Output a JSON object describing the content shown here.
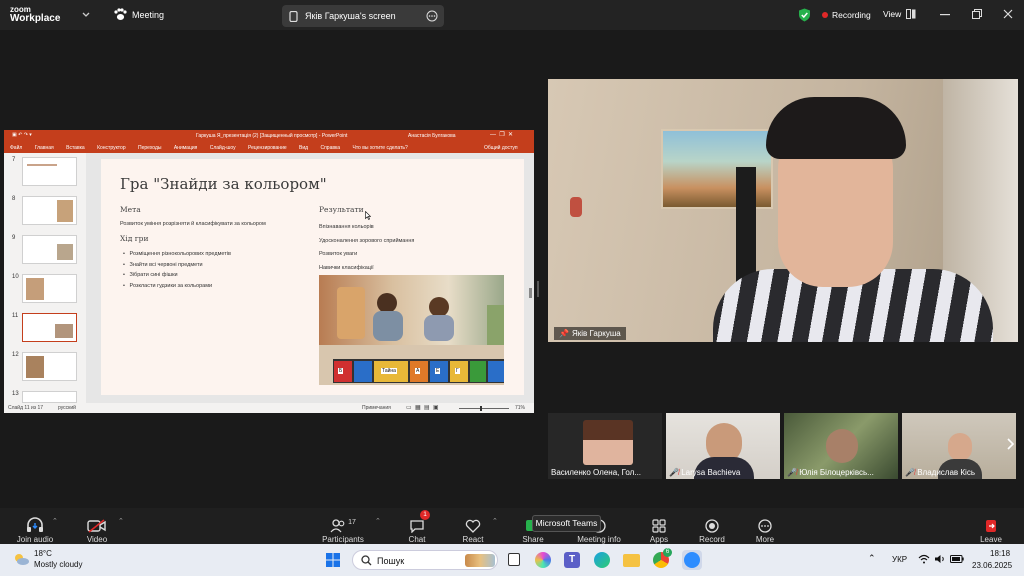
{
  "zoom": {
    "app_line1": "zoom",
    "app_line2": "Workplace",
    "meeting_label": "Meeting",
    "screen_label": "Яків Гаркуша's screen",
    "recording_label": "Recording",
    "view_label": "View"
  },
  "ppt": {
    "title": "Гаркуша Я_презентація (2) [Защищенный просмотр] - PowerPoint",
    "user": "Анастасія Булгакова",
    "menu": [
      "Файл",
      "Главная",
      "Вставка",
      "Конструктор",
      "Переходы",
      "Анимация",
      "Слайд-шоу",
      "Рецензирование",
      "Вид",
      "Справка"
    ],
    "tell_me": "Что вы хотите сделать?",
    "share": "Общий доступ",
    "thumb_numbers": [
      "7",
      "8",
      "9",
      "10",
      "11",
      "12",
      "13"
    ],
    "status_left": "Слайд 11 из 17",
    "status_lang": "русский",
    "status_notes": "Примечания",
    "status_zoom": "71%",
    "slide": {
      "title": "Гра \"Знайди за кольором\"",
      "left_heading": "Мета",
      "left_text": "Розвиток уміння розрізняти й класифікувати за кольором",
      "steps_heading": "Хід гри",
      "steps": [
        "Розміщення різнокольорових предметів",
        "Знайти всі червоні предмети",
        "Зібрати сині фішки",
        "Розкласти гудзики за кольорами"
      ],
      "right_heading": "Результати",
      "results": [
        "Впізнавання кольорів",
        "Удосконалення зорового сприймання",
        "Розвиток уваги",
        "Навички класифікації"
      ],
      "box_letters": [
        "Б",
        "Т",
        "А",
        "Е",
        "Г"
      ],
      "box_label": "Тайна"
    }
  },
  "speaker": {
    "name": "Яків Гаркуша"
  },
  "participants": [
    {
      "name": "Василенко Олена, Гол..."
    },
    {
      "name": "Larysa Bachieva"
    },
    {
      "name": "Юлія Білоцерківсь..."
    },
    {
      "name": "Владислав Кісь"
    }
  ],
  "toolbar": {
    "join_audio": "Join audio",
    "video": "Video",
    "participants": "Participants",
    "participants_count": "17",
    "chat": "Chat",
    "chat_badge": "1",
    "react": "React",
    "share": "Share",
    "meeting_info": "Meeting info",
    "apps": "Apps",
    "record": "Record",
    "more": "More",
    "leave": "Leave",
    "tooltip": "Microsoft Teams"
  },
  "taskbar": {
    "temp": "18°C",
    "weather": "Mostly cloudy",
    "search_placeholder": "Пошук",
    "lang": "УКР",
    "time": "18:18",
    "date": "23.06.2025",
    "edge_badge": "6"
  }
}
